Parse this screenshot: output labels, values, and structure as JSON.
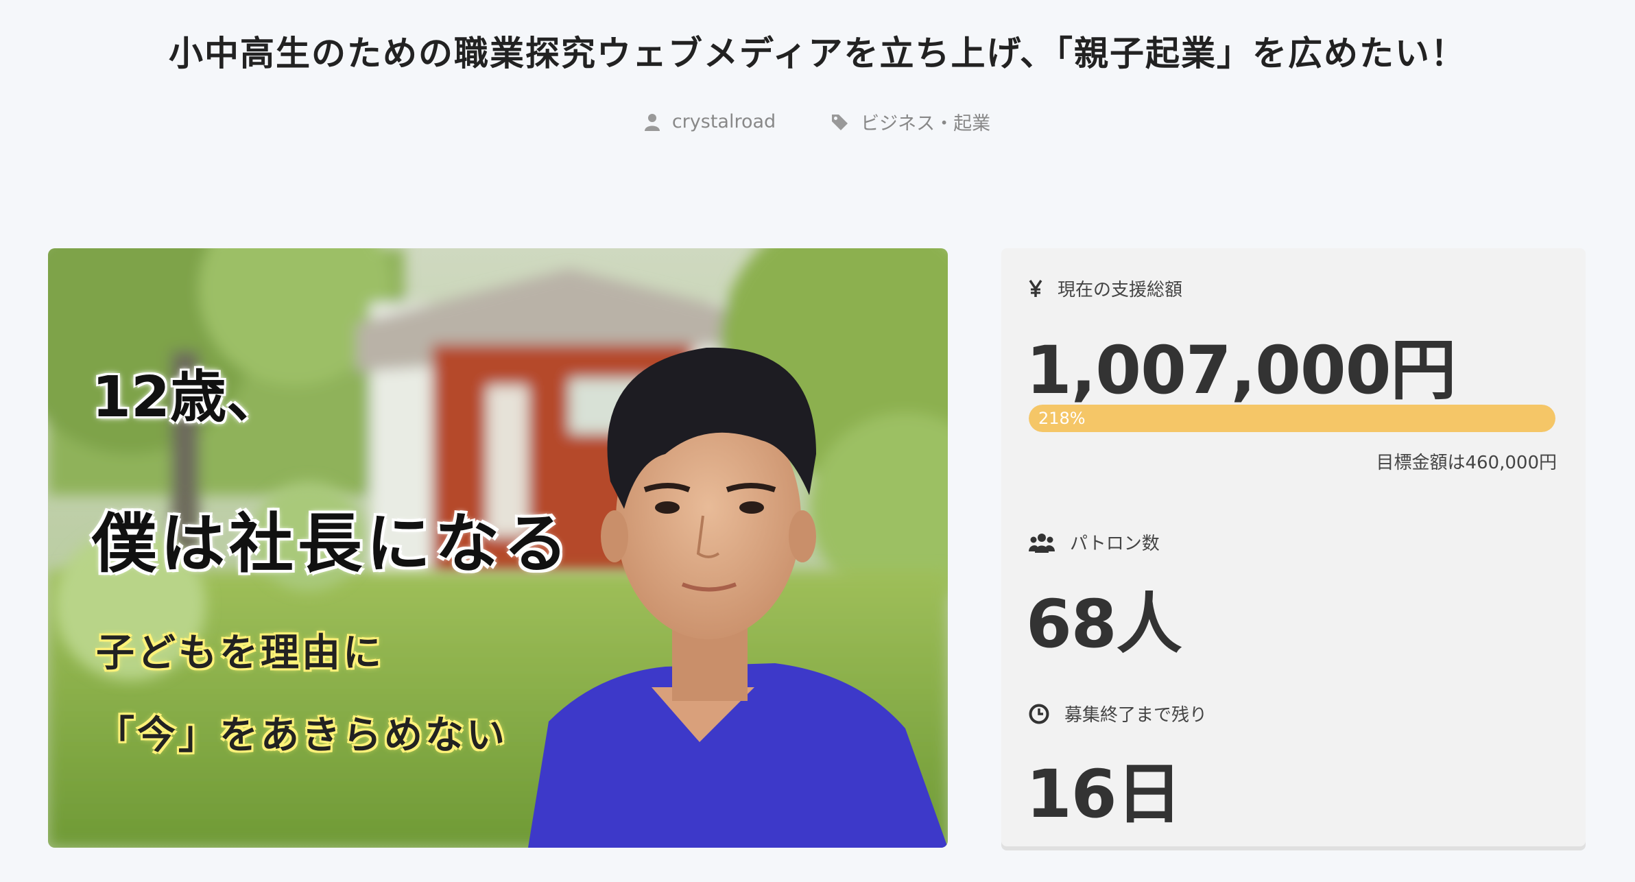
{
  "project": {
    "title": "小中高生のための職業探究ウェブメディアを立ち上げ、「親子起業」を広めたい！",
    "author": "crystalroad",
    "category": "ビジネス・起業"
  },
  "hero": {
    "line_age": "12歳、",
    "line_ceo": "僕は社長になる",
    "line_sub1": "子どもを理由に",
    "line_sub2": "「今」をあきらめない"
  },
  "stats": {
    "funding_label": "現在の支援総額",
    "funding_amount": "1,007,000円",
    "progress_text": "218%",
    "progress_fraction": 1.0,
    "target_text": "目標金額は460,000円",
    "patrons_label": "パトロン数",
    "patrons_value": "68人",
    "remaining_label": "募集終了まで残り",
    "remaining_value": "16日"
  },
  "icons": {
    "author": "user-icon",
    "category": "tag-icon",
    "funding": "yen-icon",
    "patrons": "group-icon",
    "remaining": "clock-icon"
  },
  "colors": {
    "progress_fill": "#f5c667",
    "background": "#f5f7fa",
    "panel": "#f2f2f2",
    "shirt": "#3d39c9"
  }
}
